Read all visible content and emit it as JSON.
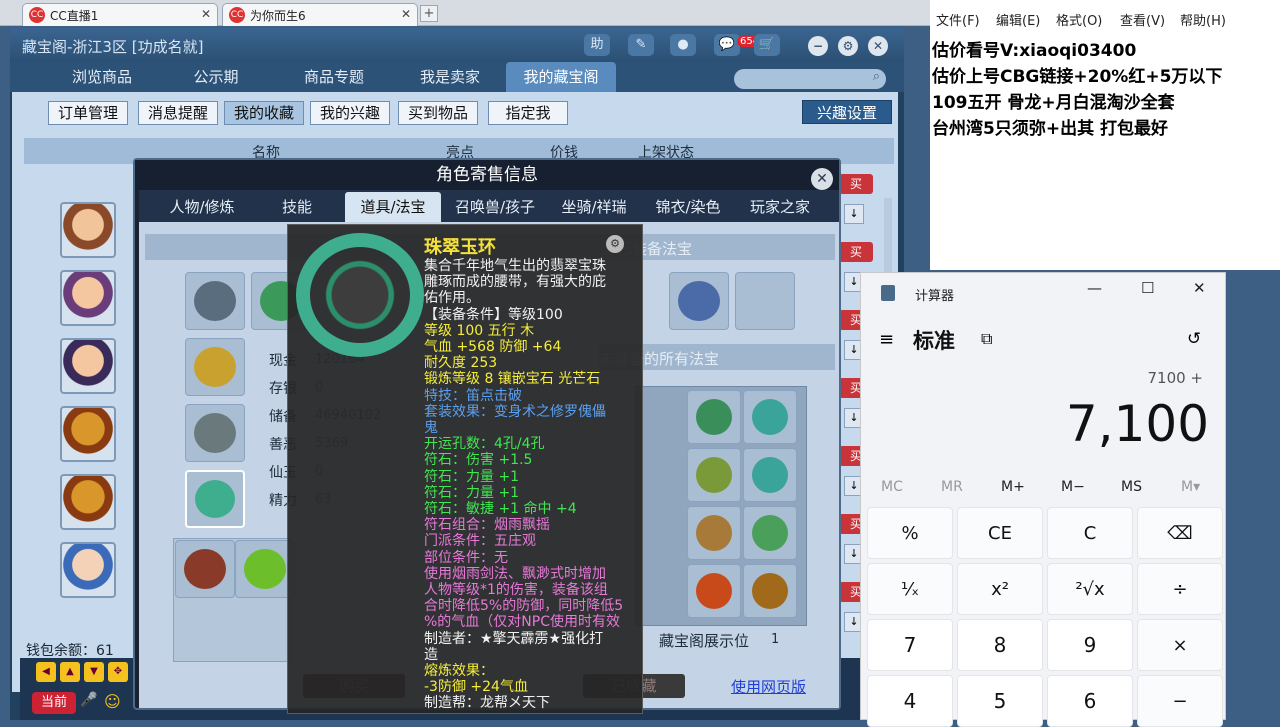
{
  "browser": {
    "tabs": [
      {
        "label": "CC直播1",
        "icon": "cc-icon"
      },
      {
        "label": "为你而生6",
        "icon": "cc-icon"
      }
    ],
    "new_tab": "+"
  },
  "game": {
    "title": "藏宝阁-浙江3区 [功成名就]",
    "title_buttons": {
      "help": "助",
      "notify_count": "654"
    },
    "nav": [
      "浏览商品",
      "公示期",
      "商品专题",
      "我是卖家",
      "我的藏宝阁"
    ],
    "nav_active": "我的藏宝阁",
    "subnav": [
      "订单管理",
      "消息提醒",
      "我的收藏",
      "我的兴趣",
      "买到物品",
      "指定我"
    ],
    "subnav_active": "我的收藏",
    "interest_button": "兴趣设置",
    "table_headers": [
      "名称",
      "亮点",
      "价钱",
      "上架状态"
    ],
    "row_buy": "买",
    "row_arrow": "↓",
    "wallet_label": "钱包余额：61",
    "bottom_label": "当前"
  },
  "dialog": {
    "title": "角色寄售信息",
    "tabs": [
      "人物/修炼",
      "技能",
      "道具/法宝",
      "召唤兽/孩子",
      "坐骑/祥瑞",
      "锦衣/染色",
      "玩家之家"
    ],
    "active_tab": "道具/法宝",
    "equipped_fabao": "已装备法宝",
    "unequipped_fabao": "未装备的所有法宝",
    "stats": [
      {
        "label": "现金",
        "value": "120164"
      },
      {
        "label": "存银",
        "value": "0"
      },
      {
        "label": "储备",
        "value": "46940102"
      },
      {
        "label": "善恶",
        "value": "5369"
      },
      {
        "label": "仙玉",
        "value": "0"
      },
      {
        "label": "精力",
        "value": "63"
      }
    ],
    "showcase_label": "藏宝阁展示位",
    "showcase_value": "1",
    "buy_button": "购买",
    "collected_button": "已收藏",
    "web_link": "使用网页版"
  },
  "tooltip": {
    "name": "珠翠玉环",
    "lines": [
      {
        "text": "集合千年地气生出的翡翠宝珠",
        "c": "w"
      },
      {
        "text": "雕琢而成的腰带，有强大的庇",
        "c": "w"
      },
      {
        "text": "佑作用。",
        "c": "w"
      },
      {
        "text": "【装备条件】等级100",
        "c": "w"
      },
      {
        "text": "等级 100  五行 木",
        "c": "y"
      },
      {
        "text": "气血 +568  防御 +64",
        "c": "y"
      },
      {
        "text": "耐久度 253",
        "c": "y"
      },
      {
        "text": "锻炼等级 8   镶嵌宝石 光芒石",
        "c": "y"
      },
      {
        "text": "特技：笛点击破",
        "c": "b"
      },
      {
        "text": "套装效果：变身术之修罗傀儡",
        "c": "b"
      },
      {
        "text": "鬼",
        "c": "b"
      },
      {
        "text": "开运孔数：4孔/4孔",
        "c": "g"
      },
      {
        "text": "符石：伤害 +1.5",
        "c": "g"
      },
      {
        "text": "符石：力量 +1",
        "c": "g"
      },
      {
        "text": "符石：力量 +1",
        "c": "g"
      },
      {
        "text": "符石：敏捷 +1 命中 +4",
        "c": "g"
      },
      {
        "text": "符石组合：烟雨飘摇",
        "c": "m"
      },
      {
        "text": "门派条件：五庄观",
        "c": "m"
      },
      {
        "text": "部位条件：无",
        "c": "m"
      },
      {
        "text": "使用烟雨剑法、飘渺式时增加",
        "c": "m"
      },
      {
        "text": "人物等级*1的伤害，装备该组",
        "c": "m"
      },
      {
        "text": "合时降低5%的防御，同时降低5",
        "c": "m"
      },
      {
        "text": "%的气血（仅对NPC使用时有效",
        "c": "m"
      },
      {
        "text": "制造者：★擎天霹雳★强化打",
        "c": "w"
      },
      {
        "text": "造",
        "c": "w"
      },
      {
        "text": "熔炼效果：",
        "c": "y"
      },
      {
        "text": "-3防御 +24气血",
        "c": "y"
      },
      {
        "text": "制造帮：龙帮メ天下",
        "c": "w"
      }
    ]
  },
  "notepad": {
    "menu": [
      "文件(F)",
      "编辑(E)",
      "格式(O)",
      "查看(V)",
      "帮助(H)"
    ],
    "lines": [
      "估价看号V:xiaoqi03400",
      "估价上号CBG链接+20%红+5万以下",
      "109五开 骨龙+月白混淘沙全套",
      "台州湾5只须弥+出其 打包最好"
    ]
  },
  "calculator": {
    "title": "计算器",
    "mode": "标准",
    "expression": "7100 +",
    "display": "7,100",
    "memory": [
      "MC",
      "MR",
      "M+",
      "M−",
      "MS",
      "M▾"
    ],
    "keys": [
      "%",
      "CE",
      "C",
      "⌫",
      "¹⁄ₓ",
      "x²",
      "²√x",
      "÷",
      "7",
      "8",
      "9",
      "×",
      "4",
      "5",
      "6",
      "−"
    ]
  }
}
